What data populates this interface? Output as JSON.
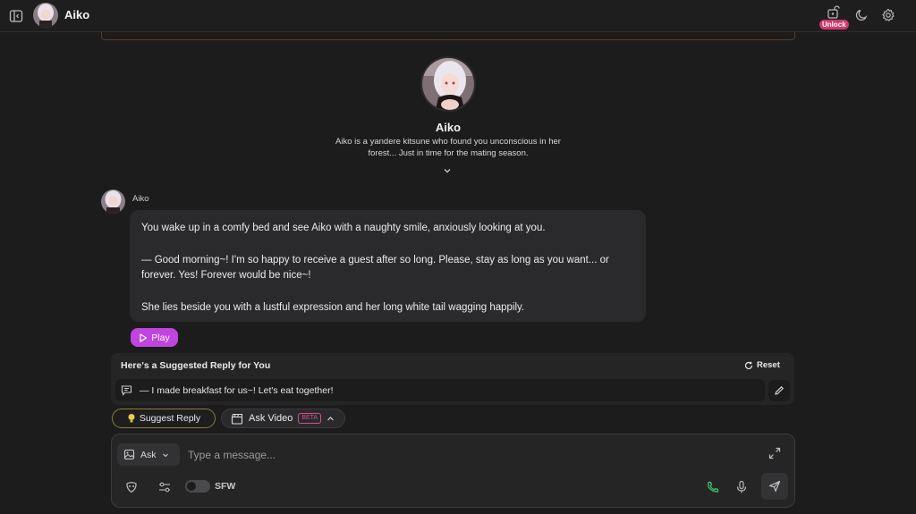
{
  "header": {
    "character_name": "Aiko",
    "unlock_label": "Unlock"
  },
  "profile": {
    "name": "Aiko",
    "description": "Aiko is a yandere kitsune who found you unconscious in her forest... Just in time for the mating season."
  },
  "message": {
    "sender": "Aiko",
    "paragraphs": [
      "You wake up in a comfy bed and see Aiko with a naughty smile, anxiously looking at you.",
      "— Good morning~! I'm so happy to receive a guest after so long. Please, stay as long as you want... or forever. Yes! Forever would be nice~!",
      "She lies beside you with a lustful expression and her long white tail wagging happily."
    ],
    "play_label": "Play"
  },
  "suggestion": {
    "title": "Here's a Suggested Reply for You",
    "reset_label": "Reset",
    "text": "— I made breakfast for us~! Let's eat together!"
  },
  "actions": {
    "suggest_reply_label": "Suggest Reply",
    "ask_video_label": "Ask Video",
    "beta_label": "BETA"
  },
  "composer": {
    "mode_label": "Ask",
    "placeholder": "Type a message...",
    "sfw_label": "SFW",
    "sfw_enabled": false
  },
  "colors": {
    "accent_purple": "#c044e0",
    "unlock_pink": "#d1386f",
    "call_green": "#3cc46a",
    "background": "#1c1c1d"
  }
}
